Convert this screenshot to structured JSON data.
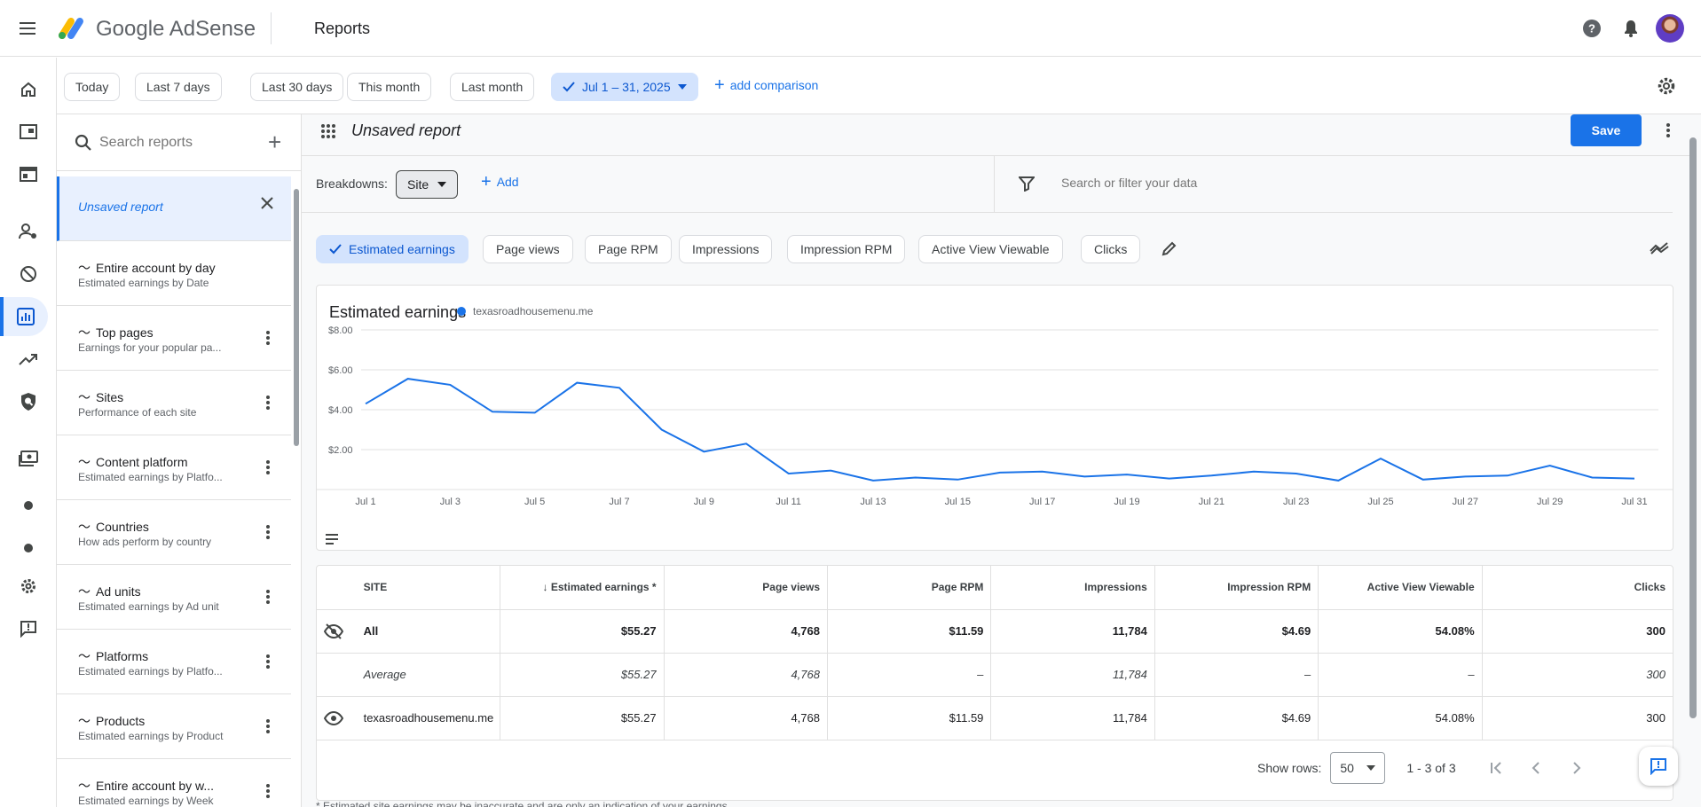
{
  "app": {
    "brand": "Google AdSense",
    "page_title": "Reports"
  },
  "rail": {
    "icons": [
      "home-icon",
      "ads-icon",
      "sites-icon",
      "account-icon",
      "blocking-icon",
      "reports-icon",
      "optimization-icon",
      "policy-icon",
      "payments-icon",
      "dot",
      "dot",
      "settings-icon",
      "feedback-icon"
    ]
  },
  "datebar": {
    "chips": [
      "Today",
      "Last 7 days",
      "Last 30 days",
      "This month",
      "Last month"
    ],
    "selected_range": "Jul 1 – 31, 2025",
    "add_comparison": "add comparison"
  },
  "reports": {
    "search_placeholder": "Search reports",
    "current": "Unsaved report",
    "items": [
      {
        "title": "Entire account by day",
        "subtitle": "Estimated earnings by Date"
      },
      {
        "title": "Top pages",
        "subtitle": "Earnings for your popular pa..."
      },
      {
        "title": "Sites",
        "subtitle": "Performance of each site"
      },
      {
        "title": "Content platform",
        "subtitle": "Estimated earnings by Platfo..."
      },
      {
        "title": "Countries",
        "subtitle": "How ads perform by country"
      },
      {
        "title": "Ad units",
        "subtitle": "Estimated earnings by Ad unit"
      },
      {
        "title": "Platforms",
        "subtitle": "Estimated earnings by Platfo..."
      },
      {
        "title": "Products",
        "subtitle": "Estimated earnings by Product"
      },
      {
        "title": "Entire account by w...",
        "subtitle": "Estimated earnings by Week"
      }
    ]
  },
  "report": {
    "title": "Unsaved report",
    "save_label": "Save",
    "breakdowns_label": "Breakdowns:",
    "breakdown_value": "Site",
    "add_label": "Add",
    "filter_placeholder": "Search or filter your data",
    "metrics": [
      "Estimated earnings",
      "Page views",
      "Page RPM",
      "Impressions",
      "Impression RPM",
      "Active View Viewable",
      "Clicks"
    ]
  },
  "colors": {
    "accent": "#1a73e8",
    "selected_chip": "#d3e3fd"
  },
  "chart_data": {
    "type": "line",
    "title": "Estimated earnings",
    "series": [
      {
        "name": "texasroadhousemenu.me",
        "values": [
          4.3,
          5.55,
          5.25,
          3.9,
          3.85,
          5.35,
          5.1,
          3.0,
          1.9,
          2.3,
          0.8,
          0.95,
          0.45,
          0.6,
          0.5,
          0.85,
          0.9,
          0.65,
          0.75,
          0.55,
          0.7,
          0.9,
          0.8,
          0.45,
          1.55,
          0.5,
          0.65,
          0.7,
          1.2,
          0.6,
          0.55
        ]
      }
    ],
    "x": [
      "Jul 1",
      "Jul 2",
      "Jul 3",
      "Jul 4",
      "Jul 5",
      "Jul 6",
      "Jul 7",
      "Jul 8",
      "Jul 9",
      "Jul 10",
      "Jul 11",
      "Jul 12",
      "Jul 13",
      "Jul 14",
      "Jul 15",
      "Jul 16",
      "Jul 17",
      "Jul 18",
      "Jul 19",
      "Jul 20",
      "Jul 21",
      "Jul 22",
      "Jul 23",
      "Jul 24",
      "Jul 25",
      "Jul 26",
      "Jul 27",
      "Jul 28",
      "Jul 29",
      "Jul 30",
      "Jul 31"
    ],
    "x_tick_labels": [
      "Jul 1",
      "Jul 3",
      "Jul 5",
      "Jul 7",
      "Jul 9",
      "Jul 11",
      "Jul 13",
      "Jul 15",
      "Jul 17",
      "Jul 19",
      "Jul 21",
      "Jul 23",
      "Jul 25",
      "Jul 27",
      "Jul 29",
      "Jul 31"
    ],
    "y_tick_labels": [
      "$8.00",
      "$6.00",
      "$4.00",
      "$2.00"
    ],
    "y_ticks": [
      8,
      6,
      4,
      2
    ],
    "ylim": [
      0,
      8
    ],
    "grid": true,
    "legend": "top-left"
  },
  "table": {
    "columns": [
      "SITE",
      "Estimated earnings *",
      "Page views",
      "Page RPM",
      "Impressions",
      "Impression RPM",
      "Active View Viewable",
      "Clicks"
    ],
    "rows": [
      {
        "kind": "all",
        "cells": [
          "All",
          "$55.27",
          "4,768",
          "$11.59",
          "11,784",
          "$4.69",
          "54.08%",
          "300"
        ]
      },
      {
        "kind": "avg",
        "cells": [
          "Average",
          "$55.27",
          "4,768",
          "–",
          "11,784",
          "–",
          "–",
          "300"
        ]
      },
      {
        "kind": "site",
        "cells": [
          "texasroadhousemenu.me",
          "$55.27",
          "4,768",
          "$11.59",
          "11,784",
          "$4.69",
          "54.08%",
          "300"
        ]
      }
    ],
    "show_rows_label": "Show rows:",
    "rows_value": "50",
    "range_label": "1 - 3 of 3"
  },
  "footnote": "* Estimated site earnings may be inaccurate and are only an indication of your earnings."
}
